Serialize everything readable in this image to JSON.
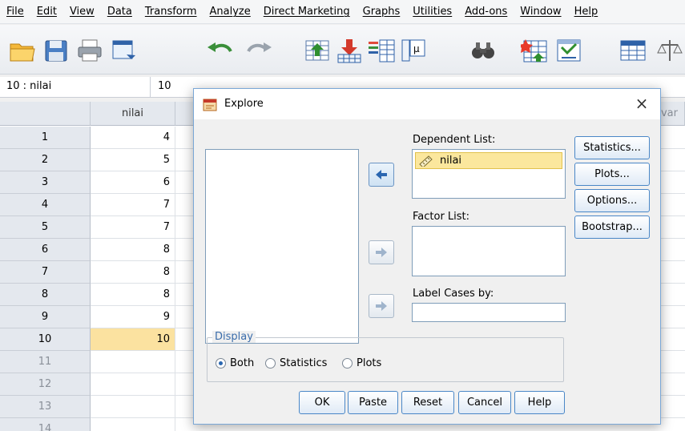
{
  "menubar": {
    "items": [
      "File",
      "Edit",
      "View",
      "Data",
      "Transform",
      "Analyze",
      "Direct Marketing",
      "Graphs",
      "Utilities",
      "Add-ons",
      "Window",
      "Help"
    ]
  },
  "toolbar": {
    "icons": [
      "open-folder-icon",
      "save-icon",
      "print-icon",
      "dialog-recall-icon",
      "undo-icon",
      "redo-icon",
      "goto-case-icon",
      "goto-variable-icon",
      "variables-icon",
      "run-descriptives-icon",
      "find-icon",
      "insert-cases-icon",
      "split-file-icon",
      "weight-cases-icon",
      "scale-icon"
    ]
  },
  "cell_ref": {
    "name": "10 : nilai",
    "value": "10"
  },
  "grid": {
    "column_header": "nilai",
    "next_column_header": "var",
    "rows": [
      {
        "num": "1",
        "value": "4"
      },
      {
        "num": "2",
        "value": "5"
      },
      {
        "num": "3",
        "value": "6"
      },
      {
        "num": "4",
        "value": "7"
      },
      {
        "num": "5",
        "value": "7"
      },
      {
        "num": "6",
        "value": "8"
      },
      {
        "num": "7",
        "value": "8"
      },
      {
        "num": "8",
        "value": "8"
      },
      {
        "num": "9",
        "value": "9"
      },
      {
        "num": "10",
        "value": "10"
      },
      {
        "num": "11",
        "value": ""
      },
      {
        "num": "12",
        "value": ""
      },
      {
        "num": "13",
        "value": ""
      },
      {
        "num": "14",
        "value": ""
      }
    ],
    "active_row": "10"
  },
  "dialog": {
    "title": "Explore",
    "close": "×",
    "dependent_list": {
      "label": "Dependent List:",
      "item": "nilai"
    },
    "factor_list": {
      "label": "Factor List:"
    },
    "label_cases": {
      "label": "Label Cases by:"
    },
    "side_buttons": [
      "Statistics...",
      "Plots...",
      "Options...",
      "Bootstrap..."
    ],
    "display": {
      "legend": "Display",
      "options": [
        "Both",
        "Statistics",
        "Plots"
      ],
      "selected": "Both"
    },
    "buttons": [
      "OK",
      "Paste",
      "Reset",
      "Cancel",
      "Help"
    ]
  },
  "colors": {
    "accent": "#4a87c7",
    "active_cell": "#fbe2a0",
    "selected_item": "#fbe79d",
    "legend_text": "#3b6dab"
  }
}
